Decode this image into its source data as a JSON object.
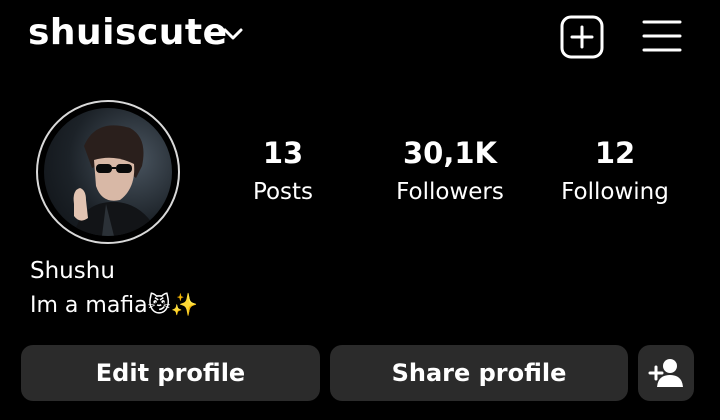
{
  "header": {
    "username": "shuiscute"
  },
  "icons": {
    "dropdown": "chevron-down-icon",
    "new_post": "plus-square-icon",
    "menu": "hamburger-menu-icon",
    "add_user": "add-person-icon"
  },
  "profile": {
    "display_name": "Shushu",
    "bio": "Im a mafia😼✨"
  },
  "stats": {
    "posts": {
      "value": "13",
      "label": "Posts"
    },
    "followers": {
      "value": "30,1K",
      "label": "Followers"
    },
    "following": {
      "value": "12",
      "label": "Following"
    }
  },
  "actions": {
    "edit_label": "Edit profile",
    "share_label": "Share profile"
  },
  "colors": {
    "background": "#000000",
    "button": "#2b2b2b",
    "text": "#ffffff"
  }
}
